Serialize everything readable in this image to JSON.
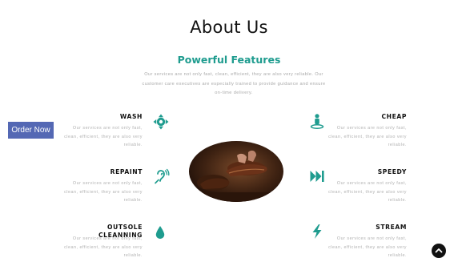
{
  "section": {
    "title": "About Us",
    "subtitle": "Powerful Features",
    "intro": "Our services are not only fast, clean, efficient, they are also very reliable. Our customer care executives are especially trained to provide guidance and ensure on-time delivery."
  },
  "order_button": {
    "label": "Order Now"
  },
  "features_left": [
    {
      "name": "WASH",
      "desc": "Our services are not only fast, clean, efficient, they are also very reliable.",
      "icon": "arrows-move-icon"
    },
    {
      "name": "REPAINT",
      "desc": "Our services are not only fast, clean, efficient, they are also very reliable.",
      "icon": "ear-assist-icon"
    },
    {
      "name": "OUTSOLE CLEANNING",
      "desc": "Our services are not only fast, clean, efficient, they are also very reliable.",
      "icon": "water-drop-icon"
    }
  ],
  "features_right": [
    {
      "name": "CHEAP",
      "desc": "Our services are not only fast, clean, efficient, they are also very reliable.",
      "icon": "person-pin-icon"
    },
    {
      "name": "SPEEDY",
      "desc": "Our services are not only fast, clean, efficient, they are also very reliable.",
      "icon": "fast-forward-icon"
    },
    {
      "name": "STREAM",
      "desc": "Our services are not only fast, clean, efficient, they are also very reliable.",
      "icon": "lightning-icon"
    }
  ],
  "colors": {
    "accent": "#1f9c8f",
    "button": "#5468b4",
    "text_muted": "#b0b0b0"
  }
}
